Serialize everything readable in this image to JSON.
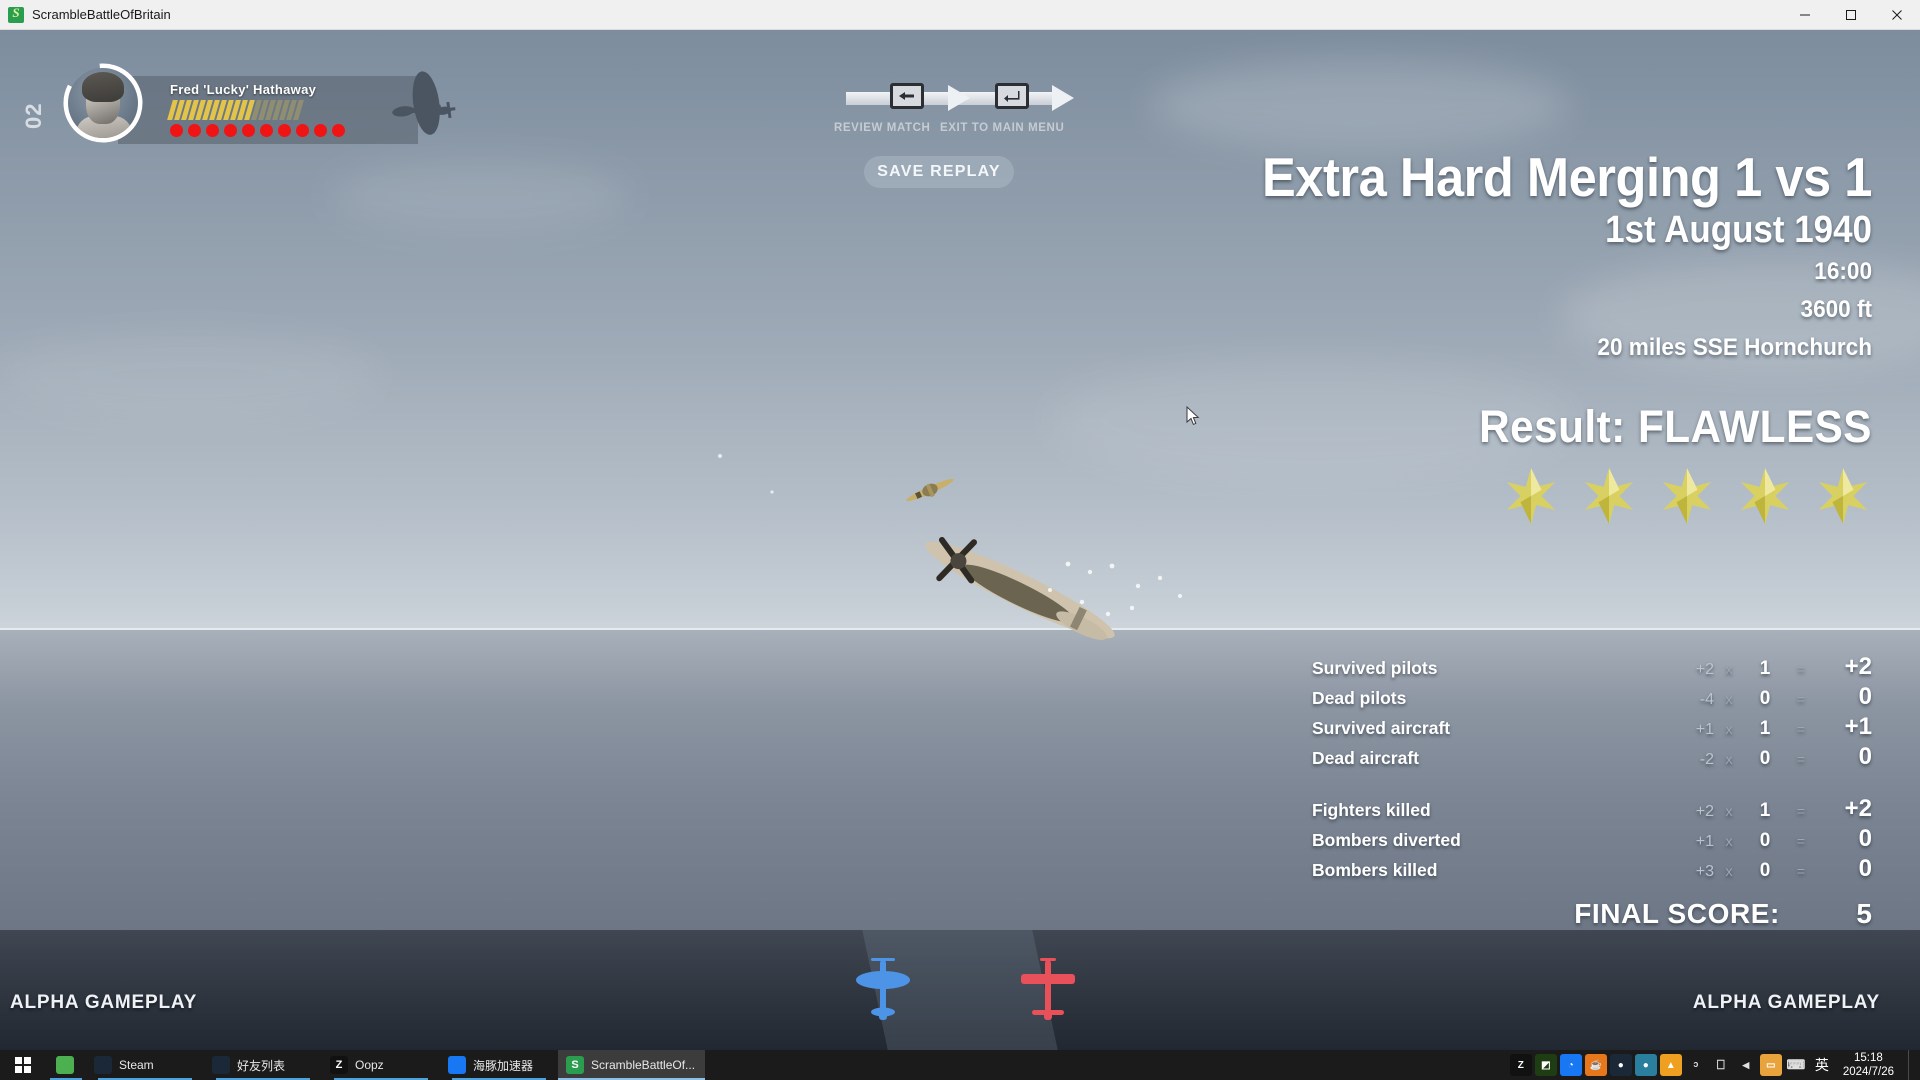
{
  "window": {
    "title": "ScrambleBattleOfBritain",
    "app_icon": "scramble-app-icon",
    "minimize": "minimize-icon",
    "maximize": "maximize-icon",
    "close": "close-icon"
  },
  "hud": {
    "squadron_number": "02",
    "pilot_name": "Fred 'Lucky' Hathaway",
    "ammo_bright": 12,
    "ammo_dim": 7,
    "hit_markers": 10
  },
  "nav": {
    "review_label": "REVIEW MATCH",
    "exit_label": "EXIT TO MAIN MENU",
    "save_replay_label": "SAVE REPLAY",
    "key_back": "←",
    "key_enter": "↵"
  },
  "results": {
    "mission_title": "Extra Hard Merging 1 vs 1",
    "date": "1st August 1940",
    "time": "16:00",
    "altitude": "3600 ft",
    "location": "20 miles SSE Hornchurch",
    "result_line": "Result: FLAWLESS",
    "stars": 5,
    "star_color": "#d9d062"
  },
  "score": {
    "rows_group1": [
      {
        "label": "Survived pilots",
        "mult": "+2",
        "x": "x",
        "count": "1",
        "eq": "=",
        "value": "+2"
      },
      {
        "label": "Dead pilots",
        "mult": "-4",
        "x": "x",
        "count": "0",
        "eq": "=",
        "value": "0"
      },
      {
        "label": "Survived aircraft",
        "mult": "+1",
        "x": "x",
        "count": "1",
        "eq": "=",
        "value": "+1"
      },
      {
        "label": "Dead aircraft",
        "mult": "-2",
        "x": "x",
        "count": "0",
        "eq": "=",
        "value": "0"
      }
    ],
    "rows_group2": [
      {
        "label": "Fighters killed",
        "mult": "+2",
        "x": "x",
        "count": "1",
        "eq": "=",
        "value": "+2"
      },
      {
        "label": "Bombers diverted",
        "mult": "+1",
        "x": "x",
        "count": "0",
        "eq": "=",
        "value": "0"
      },
      {
        "label": "Bombers killed",
        "mult": "+3",
        "x": "x",
        "count": "0",
        "eq": "=",
        "value": "0"
      }
    ],
    "final_label": "FINAL SCORE:",
    "final_value": "5"
  },
  "watermark": {
    "left": "ALPHA GAMEPLAY",
    "right": "ALPHA GAMEPLAY"
  },
  "radar": {
    "friendly_color": "#4d94e6",
    "enemy_color": "#e8505a"
  },
  "taskbar": {
    "start_label": "start-button",
    "items": [
      {
        "name": "minecraft",
        "label": "",
        "icon_text": "",
        "color": "#4caf50",
        "active": false,
        "iconOnly": true
      },
      {
        "name": "steam",
        "label": "Steam",
        "icon_text": "",
        "color": "#1b2838",
        "active": false,
        "iconOnly": false
      },
      {
        "name": "steam-friends",
        "label": "好友列表",
        "icon_text": "",
        "color": "#1b2838",
        "active": false,
        "iconOnly": false
      },
      {
        "name": "oopz",
        "label": "Oopz",
        "icon_text": "Z",
        "color": "#111111",
        "active": false,
        "iconOnly": false
      },
      {
        "name": "dolphin-accelerator",
        "label": "海豚加速器",
        "icon_text": "",
        "color": "#1877f2",
        "active": false,
        "iconOnly": false
      },
      {
        "name": "scramble-battle-of-britain",
        "label": "ScrambleBattleOf...",
        "icon_text": "S",
        "color": "#2a9d4f",
        "active": true,
        "iconOnly": false
      }
    ],
    "tray": [
      {
        "name": "oopz-tray",
        "glyph": "Z",
        "color": "#111111"
      },
      {
        "name": "nvidia-tray",
        "glyph": "◩",
        "color": "#1f3d12"
      },
      {
        "name": "dolphin-tray",
        "glyph": "◔",
        "color": "#1877f2"
      },
      {
        "name": "java-tray",
        "glyph": "☕",
        "color": "#e8761b"
      },
      {
        "name": "steam-tray",
        "glyph": "●",
        "color": "#1b2838"
      },
      {
        "name": "tencent-tray",
        "glyph": "●",
        "color": "#2a7f9e"
      },
      {
        "name": "huorong-tray",
        "glyph": "▲",
        "color": "#f0a020"
      },
      {
        "name": "microphone-tray",
        "glyph": "ᵓ",
        "color": "transparent"
      },
      {
        "name": "network-tray",
        "glyph": "⎕",
        "color": "transparent"
      },
      {
        "name": "volume-tray",
        "glyph": "◂",
        "color": "transparent"
      },
      {
        "name": "explorer-tray",
        "glyph": "▭",
        "color": "#e8a33d"
      },
      {
        "name": "keyboard-tray",
        "glyph": "⌨",
        "color": "transparent"
      }
    ],
    "ime": "英",
    "clock_time": "15:18",
    "clock_date": "2024/7/26"
  }
}
